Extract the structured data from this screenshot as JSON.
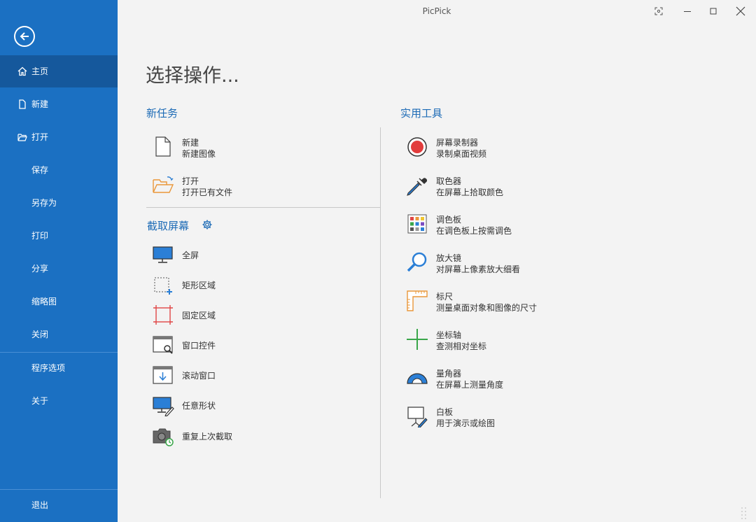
{
  "window": {
    "title": "PicPick"
  },
  "sidebar": {
    "items": [
      {
        "label": "主页"
      },
      {
        "label": "新建"
      },
      {
        "label": "打开"
      },
      {
        "label": "保存"
      },
      {
        "label": "另存为"
      },
      {
        "label": "打印"
      },
      {
        "label": "分享"
      },
      {
        "label": "缩略图"
      },
      {
        "label": "关闭"
      },
      {
        "label": "程序选项"
      },
      {
        "label": "关于"
      },
      {
        "label": "退出"
      }
    ]
  },
  "main": {
    "heading": "选择操作...",
    "new_task": {
      "title": "新任务",
      "items": [
        {
          "title": "新建",
          "subtitle": "新建图像",
          "icon": "new-file-icon"
        },
        {
          "title": "打开",
          "subtitle": "打开已有文件",
          "icon": "open-folder-icon"
        }
      ]
    },
    "capture": {
      "title": "截取屏幕",
      "items": [
        {
          "title": "全屏",
          "icon": "monitor-icon"
        },
        {
          "title": "矩形区域",
          "icon": "rectangle-select-icon"
        },
        {
          "title": "固定区域",
          "icon": "fixed-region-icon"
        },
        {
          "title": "窗口控件",
          "icon": "window-control-icon"
        },
        {
          "title": "滚动窗口",
          "icon": "scroll-window-icon"
        },
        {
          "title": "任意形状",
          "icon": "freehand-icon"
        },
        {
          "title": "重复上次截取",
          "icon": "repeat-capture-icon"
        }
      ]
    },
    "tools": {
      "title": "实用工具",
      "items": [
        {
          "title": "屏幕录制器",
          "subtitle": "录制桌面视频",
          "icon": "record-icon"
        },
        {
          "title": "取色器",
          "subtitle": "在屏幕上拾取颜色",
          "icon": "eyedropper-icon"
        },
        {
          "title": "调色板",
          "subtitle": "在调色板上按需调色",
          "icon": "palette-icon"
        },
        {
          "title": "放大镜",
          "subtitle": "对屏幕上像素放大细看",
          "icon": "magnifier-icon"
        },
        {
          "title": "标尺",
          "subtitle": "测量桌面对象和图像的尺寸",
          "icon": "ruler-icon"
        },
        {
          "title": "坐标轴",
          "subtitle": "查测相对坐标",
          "icon": "crosshair-icon"
        },
        {
          "title": "量角器",
          "subtitle": "在屏幕上测量角度",
          "icon": "protractor-icon"
        },
        {
          "title": "白板",
          "subtitle": "用于演示或绘图",
          "icon": "whiteboard-icon"
        }
      ]
    }
  },
  "colors": {
    "sidebar": "#1b70c2",
    "sidebar_active": "#15589c",
    "accent": "#1d6bb6"
  }
}
